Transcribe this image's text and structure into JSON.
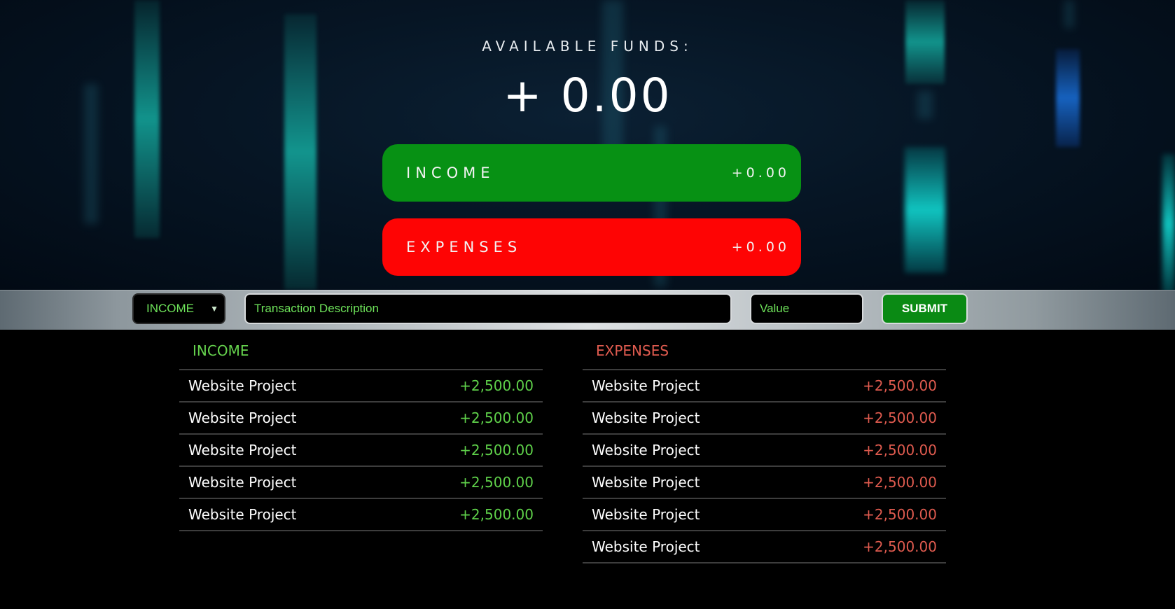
{
  "header": {
    "funds_label": "AVAILABLE FUNDS:",
    "funds_value": "+ 0.00"
  },
  "summary": {
    "income_label": "INCOME",
    "income_value": "+0.00",
    "expenses_label": "EXPENSES",
    "expenses_value": "+0.00"
  },
  "form": {
    "type_selected": "INCOME",
    "description_placeholder": "Transaction Description",
    "value_placeholder": "Value",
    "submit_label": "SUBMIT"
  },
  "income_list": {
    "title": "INCOME",
    "items": [
      {
        "description": "Website Project",
        "value": "+2,500.00"
      },
      {
        "description": "Website Project",
        "value": "+2,500.00"
      },
      {
        "description": "Website Project",
        "value": "+2,500.00"
      },
      {
        "description": "Website Project",
        "value": "+2,500.00"
      },
      {
        "description": "Website Project",
        "value": "+2,500.00"
      }
    ]
  },
  "expenses_list": {
    "title": "EXPENSES",
    "items": [
      {
        "description": "Website Project",
        "value": "+2,500.00"
      },
      {
        "description": "Website Project",
        "value": "+2,500.00"
      },
      {
        "description": "Website Project",
        "value": "+2,500.00"
      },
      {
        "description": "Website Project",
        "value": "+2,500.00"
      },
      {
        "description": "Website Project",
        "value": "+2,500.00"
      },
      {
        "description": "Website Project",
        "value": "+2,500.00"
      }
    ]
  },
  "colors": {
    "income_green": "#079114",
    "expenses_red": "#fe0404",
    "income_text": "#5fd14a",
    "expenses_text": "#e05b4f"
  }
}
